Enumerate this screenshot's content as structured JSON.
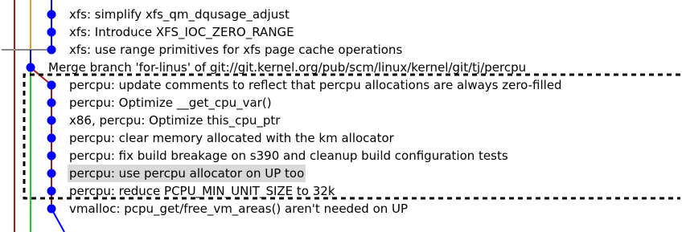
{
  "graph": {
    "colors": {
      "lane_red": "#b01818",
      "lane_orange": "#f0a020",
      "lane_gray": "#8a8a8a",
      "lane_green": "#22cc22",
      "commit_dot": "#0000ff",
      "highlight_box": "#000000",
      "selection": "#d9d9d9"
    },
    "commits": [
      {
        "subject": "xfs: simplify xfs_qm_dqusage_adjust",
        "lane": 2,
        "selected": false
      },
      {
        "subject": "xfs: Introduce XFS_IOC_ZERO_RANGE",
        "lane": 2,
        "selected": false
      },
      {
        "subject": "xfs: use range primitives for xfs page cache operations",
        "lane": 2,
        "selected": false
      },
      {
        "subject": "Merge branch 'for-linus' of git://git.kernel.org/pub/scm/linux/kernel/git/tj/percpu",
        "lane": 1,
        "selected": false
      },
      {
        "subject": "percpu: update comments to reflect that percpu allocations are always zero-filled",
        "lane": 2,
        "selected": false
      },
      {
        "subject": "percpu: Optimize __get_cpu_var()",
        "lane": 2,
        "selected": false
      },
      {
        "subject": "x86, percpu: Optimize this_cpu_ptr",
        "lane": 2,
        "selected": false
      },
      {
        "subject": "percpu: clear memory allocated with the km allocator",
        "lane": 2,
        "selected": false
      },
      {
        "subject": "percpu: fix build breakage on s390 and cleanup build configuration tests",
        "lane": 2,
        "selected": false
      },
      {
        "subject": "percpu: use percpu allocator on UP too",
        "lane": 2,
        "selected": true
      },
      {
        "subject": "percpu: reduce PCPU_MIN_UNIT_SIZE to 32k",
        "lane": 2,
        "selected": false
      },
      {
        "subject": "vmalloc: pcpu_get/free_vm_areas() aren't needed on UP",
        "lane": 2,
        "selected": false
      }
    ]
  }
}
